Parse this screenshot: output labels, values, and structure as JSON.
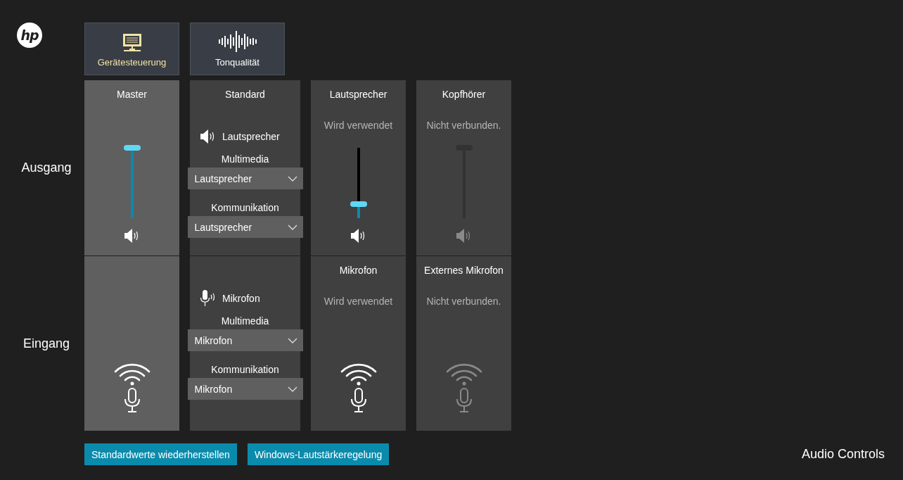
{
  "logo": {
    "text": "hp"
  },
  "tabs": [
    {
      "label": "Gerätesteuerung",
      "kind": "device",
      "selected": true
    },
    {
      "label": "Tonqualität",
      "kind": "sound",
      "selected": false
    }
  ],
  "rows": [
    {
      "label": "Ausgang",
      "kind": "output",
      "master": {
        "title": "Master",
        "level": 1
      },
      "default": {
        "title": "Standard",
        "device": "Lautsprecher",
        "selects": [
          {
            "label": "Multimedia",
            "value": "Lautsprecher"
          },
          {
            "label": "Kommunikation",
            "value": "Lautsprecher"
          }
        ]
      },
      "devices": [
        {
          "title": "Lautsprecher",
          "status": "Wird verwendet",
          "connected": true,
          "level": 0.2
        },
        {
          "title": "Kopfhörer",
          "status": "Nicht verbunden.",
          "connected": false,
          "level": 1
        }
      ]
    },
    {
      "label": "Eingang",
      "kind": "input",
      "master": {},
      "default": {
        "device": "Mikrofon",
        "selects": [
          {
            "label": "Multimedia",
            "value": "Mikrofon"
          },
          {
            "label": "Kommunikation",
            "value": "Mikrofon"
          }
        ]
      },
      "devices": [
        {
          "title": "Mikrofon",
          "status": "Wird verwendet",
          "connected": true
        },
        {
          "title": "Externes Mikrofon",
          "status": "Nicht verbunden.",
          "connected": false
        }
      ]
    }
  ],
  "buttons": [
    "Standardwerte wiederherstellen",
    "Windows-Lautstärkeregelung"
  ],
  "app_title": "Audio Controls"
}
